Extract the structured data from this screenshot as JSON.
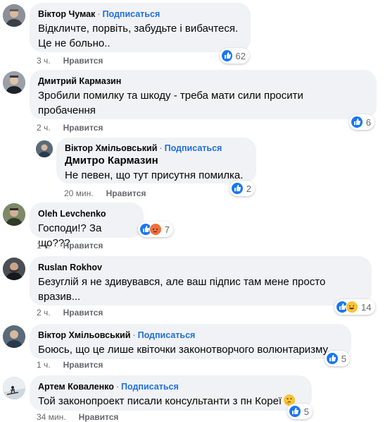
{
  "comments": [
    {
      "author": "Віктор Чумак",
      "follow": "Подписаться",
      "lines": [
        "Відкличте, порвіть, забудьте і вибачтеся.",
        "Це не больно.."
      ],
      "time": "3 ч.",
      "like": "Нравится",
      "reactions": [
        "like"
      ],
      "count": "62"
    },
    {
      "author": "Дмитрий Кармазин",
      "lines": [
        "Зробили помилку та шкоду - треба мати сили просити",
        "пробачення"
      ],
      "time": "2 ч.",
      "like": "Нравится",
      "reactions": [
        "like"
      ],
      "count": "6"
    },
    {
      "author": "Віктор Хмільовський",
      "follow": "Подписаться",
      "mention": "Дмитро Кармазин",
      "lines": [
        "Не певен, що тут присутня помилка."
      ],
      "time": "20 мин.",
      "like": "Нравится",
      "reactions": [
        "like"
      ],
      "count": "2"
    },
    {
      "author": "Oleh Levchenko",
      "lines": [
        "Господи!? За що???"
      ],
      "time": "1 ч.",
      "like": "Нравится",
      "reactions": [
        "like",
        "angry"
      ],
      "count": "7"
    },
    {
      "author": "Ruslan Rokhov",
      "lines": [
        "Безуглій я не здивувався, але ваш підпис там мене просто",
        "вразив..."
      ],
      "time": "2 ч.",
      "like": "Нравится",
      "reactions": [
        "like",
        "haha"
      ],
      "count": "14"
    },
    {
      "author": "Віктор Хмільовський",
      "follow": "Подписаться",
      "lines": [
        "Боюсь, що це лише квіточки законотворчого волюнтаризму."
      ],
      "time": "1 ч.",
      "like": "Нравится",
      "reactions": [
        "like"
      ],
      "count": "5"
    },
    {
      "author": "Артем Коваленко",
      "follow": "Подписаться",
      "lines": [
        "Той законопроект писали консультанти з пн Кореї"
      ],
      "text_emoji": "thinking-face",
      "time": "34 мин.",
      "like": "Нравится",
      "reactions": [
        "like"
      ],
      "count": "5"
    }
  ],
  "dot": "·",
  "colors": {
    "bubble": "#f0f2f5",
    "follow": "#216fdb",
    "meta": "#65676b",
    "like_reaction": "#1877f2",
    "angry_reaction": "#f0703b",
    "haha_reaction": "#f7c433"
  }
}
